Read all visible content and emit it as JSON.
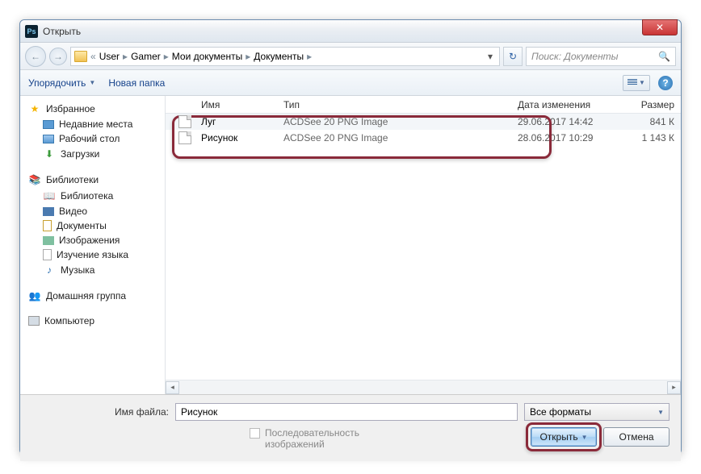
{
  "window": {
    "title": "Открыть"
  },
  "breadcrumb": {
    "parts": [
      "User",
      "Gamer",
      "Мои документы",
      "Документы"
    ]
  },
  "search": {
    "placeholder": "Поиск: Документы"
  },
  "toolbar": {
    "organize": "Упорядочить",
    "new_folder": "Новая папка"
  },
  "sidebar": {
    "favorites": {
      "label": "Избранное",
      "items": [
        "Недавние места",
        "Рабочий стол",
        "Загрузки"
      ]
    },
    "libraries": {
      "label": "Библиотеки",
      "items": [
        "Библиотека",
        "Видео",
        "Документы",
        "Изображения",
        "Изучение языка",
        "Музыка"
      ]
    },
    "homegroup": {
      "label": "Домашняя группа"
    },
    "computer": {
      "label": "Компьютер"
    }
  },
  "columns": {
    "name": "Имя",
    "type": "Тип",
    "date": "Дата изменения",
    "size": "Размер"
  },
  "files": [
    {
      "name": "Луг",
      "type": "ACDSee 20 PNG Image",
      "date": "29.06.2017 14:42",
      "size": "841 К"
    },
    {
      "name": "Рисунок",
      "type": "ACDSee 20 PNG Image",
      "date": "28.06.2017 10:29",
      "size": "1 143 К"
    }
  ],
  "bottom": {
    "filename_label": "Имя файла:",
    "filename_value": "Рисунок",
    "filter": "Все форматы",
    "sequence": "Последовательность изображений",
    "open": "Открыть",
    "cancel": "Отмена"
  }
}
